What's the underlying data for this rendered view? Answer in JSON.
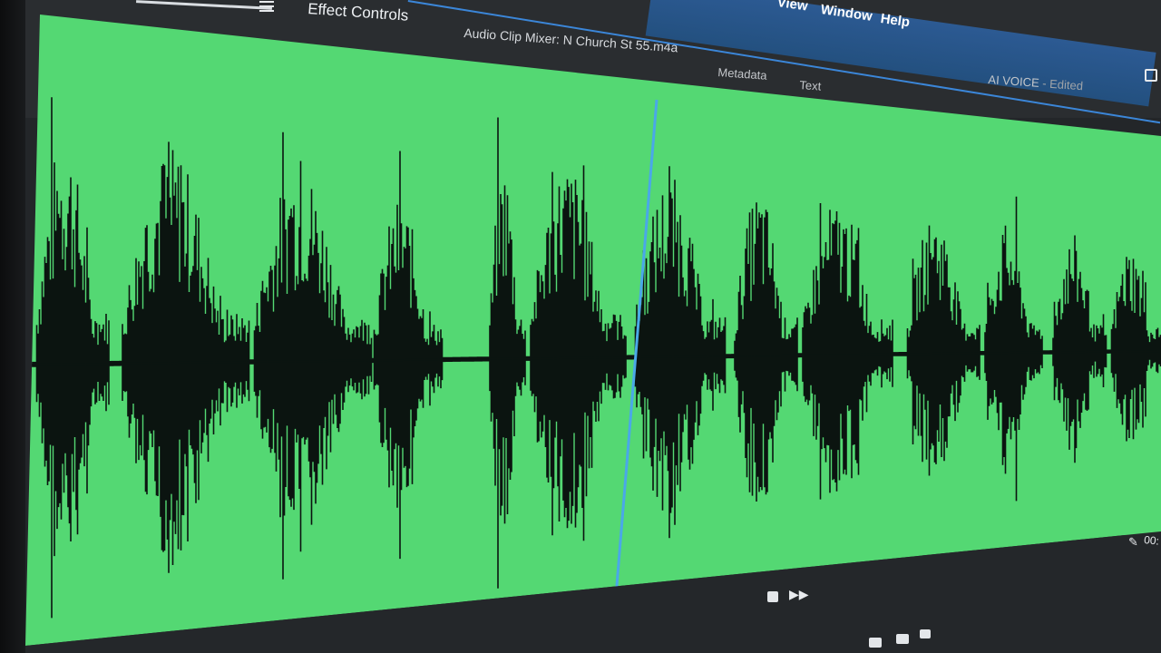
{
  "menu": {
    "items": [
      {
        "label": "View"
      },
      {
        "label": "Window"
      },
      {
        "label": "Help"
      }
    ]
  },
  "panels": {
    "effect_controls": "Effect Controls",
    "audio_clip_mixer": "Audio Clip Mixer: N Church St 55.m4a",
    "metadata": "Metadata",
    "text": "Text"
  },
  "workspace": {
    "name": "AI VOICE",
    "status": " - Edited"
  },
  "timecode": {
    "partial": "00:"
  },
  "colors": {
    "waveform_background": "#54d873",
    "waveform": "#0b1410",
    "playhead": "#4aa8e8",
    "menu_bar": "#2a5a92"
  },
  "icons": [
    "hamburger-icon",
    "lock-icon",
    "wrench-icon",
    "play-forward-icon",
    "stop-icon",
    "camera-icon",
    "export-frame-icon"
  ]
}
